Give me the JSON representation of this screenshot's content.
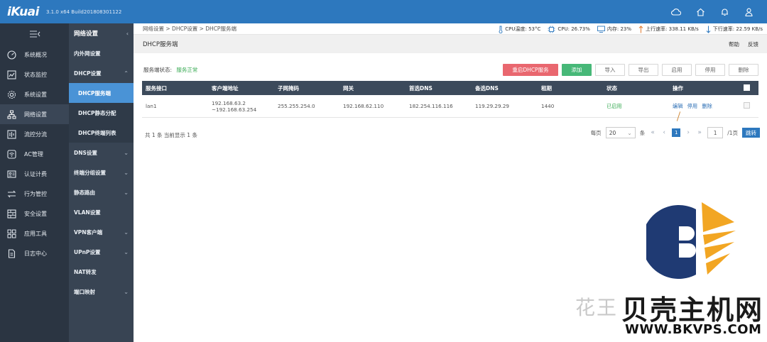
{
  "header": {
    "logo": "iKuai",
    "version": "3.1.0 x64 Build201808301122",
    "icons": [
      "cloud-icon",
      "home-icon",
      "bell-icon",
      "user-icon"
    ]
  },
  "leftnav": {
    "items": [
      {
        "label": "系统概况",
        "icon": "gauge-icon"
      },
      {
        "label": "状态监控",
        "icon": "monitor-icon"
      },
      {
        "label": "系统设置",
        "icon": "gear-icon"
      },
      {
        "label": "网络设置",
        "icon": "network-icon"
      },
      {
        "label": "流控分流",
        "icon": "flow-icon"
      },
      {
        "label": "AC管理",
        "icon": "wifi-icon"
      },
      {
        "label": "认证计费",
        "icon": "id-card-icon"
      },
      {
        "label": "行为管控",
        "icon": "arrows-icon"
      },
      {
        "label": "安全设置",
        "icon": "shield-icon"
      },
      {
        "label": "应用工具",
        "icon": "apps-icon"
      },
      {
        "label": "日志中心",
        "icon": "document-icon"
      }
    ],
    "active_index": 3
  },
  "subnav": {
    "title": "网络设置",
    "items": [
      {
        "label": "内外网设置"
      },
      {
        "label": "DHCP设置"
      },
      {
        "label": "DHCP服务端"
      },
      {
        "label": "DHCP静态分配"
      },
      {
        "label": "DHCP终端列表"
      },
      {
        "label": "DNS设置"
      },
      {
        "label": "终端分组设置"
      },
      {
        "label": "静态路由"
      },
      {
        "label": "VLAN设置"
      },
      {
        "label": "VPN客户端"
      },
      {
        "label": "UPnP设置"
      },
      {
        "label": "NAT转发"
      },
      {
        "label": "端口映射"
      }
    ]
  },
  "statusbar": {
    "breadcrumb": "网络设置 > DHCP设置 > DHCP服务端",
    "cpu_temp": "CPU温度: 53°C",
    "cpu": "CPU: 26.73%",
    "memory": "内存: 23%",
    "upload": "上行速率: 338.11 KB/s",
    "download": "下行速率: 22.59 KB/s"
  },
  "page": {
    "title": "DHCP服务端",
    "help": "帮助",
    "feedback": "反馈",
    "service_status_label": "服务端状态:",
    "service_status_value": "服务正常"
  },
  "toolbar": {
    "restart": "重启DHCP服务",
    "add": "添加",
    "import": "导入",
    "export": "导出",
    "enable": "启用",
    "disable": "停用",
    "delete": "删除"
  },
  "table": {
    "headers": [
      "服务接口",
      "客户端地址",
      "子网掩码",
      "网关",
      "首选DNS",
      "备选DNS",
      "租期",
      "状态",
      "操作"
    ],
    "rows": [
      {
        "interface": "lan1",
        "client_range_start": "192.168.63.2",
        "client_range_end": "~192.168.63.254",
        "netmask": "255.255.254.0",
        "gateway": "192.168.62.110",
        "dns1": "182.254.116.116",
        "dns2": "119.29.29.29",
        "lease": "1440",
        "status": "已启用",
        "op_edit": "编辑",
        "op_disable": "停用",
        "op_delete": "删除"
      }
    ]
  },
  "pagination": {
    "summary": "共 1 条 当前显示 1 条",
    "per_page_label": "每页",
    "per_page_value": "20",
    "per_page_unit": "条",
    "current_page": "1",
    "page_input": "1",
    "total_pages": "/1页",
    "go": "跳转"
  },
  "watermark": {
    "text": "花王",
    "brand": "贝壳主机网",
    "url": "WWW.BKVPS.COM"
  },
  "colors": {
    "topbar": "#2d78be",
    "leftnav": "#2b3542",
    "subnav": "#384453",
    "subnav_active": "#4a93d6",
    "table_header": "#3c4a5b",
    "ok_green": "#3aab55",
    "restart_red": "#e9676f",
    "add_green": "#47b878"
  }
}
